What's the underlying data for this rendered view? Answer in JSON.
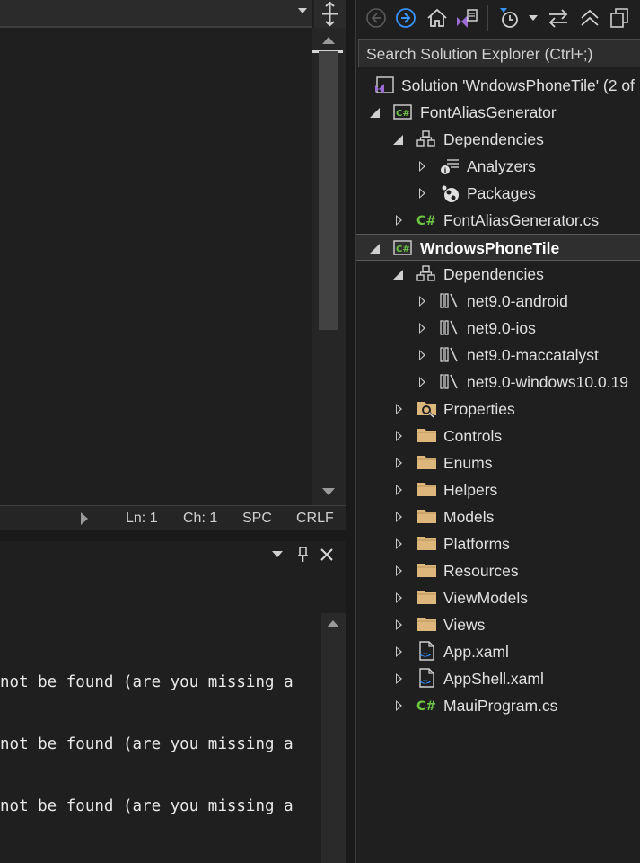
{
  "editor": {
    "status": {
      "line": "Ln: 1",
      "col": "Ch: 1",
      "spacing": "SPC",
      "line_ending": "CRLF"
    }
  },
  "output": {
    "lines": [
      "not be found (are you missing a",
      "not be found (are you missing a",
      "not be found (are you missing a"
    ]
  },
  "solution_explorer": {
    "search_placeholder": "Search Solution Explorer (Ctrl+;)",
    "toolbar_icons": [
      "back-icon",
      "forward-icon",
      "home-icon",
      "vs-switch-views-icon",
      "pending-changes-filter-icon",
      "dropdown-icon",
      "sync-icon",
      "collapse-all-icon",
      "show-all-files-icon"
    ],
    "tree": [
      {
        "label": "Solution 'WndowsPhoneTile' (2 of",
        "icon": "solution-icon",
        "state": "none",
        "depth": 0
      },
      {
        "label": "FontAliasGenerator",
        "icon": "csharp-project-icon",
        "state": "expanded",
        "depth": 1
      },
      {
        "label": "Dependencies",
        "icon": "dependencies-icon",
        "state": "expanded",
        "depth": 2
      },
      {
        "label": "Analyzers",
        "icon": "analyzers-icon",
        "state": "collapsed",
        "depth": 3
      },
      {
        "label": "Packages",
        "icon": "packages-icon",
        "state": "collapsed",
        "depth": 3
      },
      {
        "label": "FontAliasGenerator.cs",
        "icon": "csharp-file-icon",
        "state": "collapsed",
        "depth": 2
      },
      {
        "label": "WndowsPhoneTile",
        "icon": "csharp-project-icon",
        "state": "expanded",
        "depth": 1,
        "selected": true
      },
      {
        "label": "Dependencies",
        "icon": "dependencies-icon",
        "state": "expanded",
        "depth": 2
      },
      {
        "label": "net9.0-android",
        "icon": "framework-icon",
        "state": "collapsed",
        "depth": 3
      },
      {
        "label": "net9.0-ios",
        "icon": "framework-icon",
        "state": "collapsed",
        "depth": 3
      },
      {
        "label": "net9.0-maccatalyst",
        "icon": "framework-icon",
        "state": "collapsed",
        "depth": 3
      },
      {
        "label": "net9.0-windows10.0.19",
        "icon": "framework-icon",
        "state": "collapsed",
        "depth": 3
      },
      {
        "label": "Properties",
        "icon": "properties-folder-icon",
        "state": "collapsed",
        "depth": 2
      },
      {
        "label": "Controls",
        "icon": "folder-icon",
        "state": "collapsed",
        "depth": 2
      },
      {
        "label": "Enums",
        "icon": "folder-icon",
        "state": "collapsed",
        "depth": 2
      },
      {
        "label": "Helpers",
        "icon": "folder-icon",
        "state": "collapsed",
        "depth": 2
      },
      {
        "label": "Models",
        "icon": "folder-icon",
        "state": "collapsed",
        "depth": 2
      },
      {
        "label": "Platforms",
        "icon": "folder-icon",
        "state": "collapsed",
        "depth": 2
      },
      {
        "label": "Resources",
        "icon": "folder-icon",
        "state": "collapsed",
        "depth": 2
      },
      {
        "label": "ViewModels",
        "icon": "folder-icon",
        "state": "collapsed",
        "depth": 2
      },
      {
        "label": "Views",
        "icon": "folder-icon",
        "state": "collapsed",
        "depth": 2
      },
      {
        "label": "App.xaml",
        "icon": "xaml-file-icon",
        "state": "collapsed",
        "depth": 2
      },
      {
        "label": "AppShell.xaml",
        "icon": "xaml-file-icon",
        "state": "collapsed",
        "depth": 2
      },
      {
        "label": "MauiProgram.cs",
        "icon": "csharp-file-icon",
        "state": "collapsed",
        "depth": 2
      }
    ]
  },
  "colors": {
    "background": "#1f1f1f",
    "folder": "#dcb67a",
    "csharp": "#6cc644",
    "accent_blue": "#3794ff",
    "vs_purple": "#9b6bd6"
  }
}
